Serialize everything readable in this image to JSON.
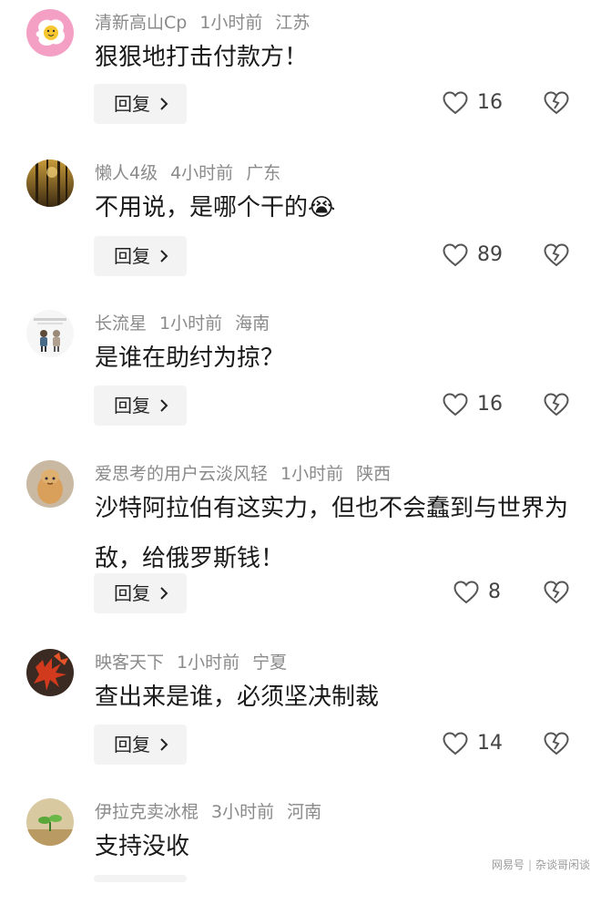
{
  "reply_label": "回复",
  "comments": [
    {
      "user": "清新高山Cp",
      "time": "1小时前",
      "location": "江苏",
      "text": "狠狠地打击付款方！",
      "likes": "16",
      "avatar": "fried-egg-avatar"
    },
    {
      "user": "懒人4级",
      "time": "4小时前",
      "location": "广东",
      "text": "不用说，是哪个干的",
      "emoji": "😭",
      "likes": "89",
      "avatar": "forest-avatar"
    },
    {
      "user": "长流星",
      "time": "1小时前",
      "location": "海南",
      "text": "是谁在助纣为掠？",
      "likes": "16",
      "avatar": "couple-illustration-avatar"
    },
    {
      "user": "爱思考的用户云淡风轻",
      "time": "1小时前",
      "location": "陕西",
      "text": "沙特阿拉伯有这实力，但也不会蠢到与世界为敌，给俄罗斯钱！",
      "likes": "8",
      "avatar": "cartoon-face-avatar"
    },
    {
      "user": "映客天下",
      "time": "1小时前",
      "location": "宁夏",
      "text": "查出来是谁，必须坚决制裁",
      "likes": "14",
      "avatar": "red-maple-avatar"
    },
    {
      "user": "伊拉克卖冰棍",
      "time": "3小时前",
      "location": "河南",
      "text": "支持没收",
      "avatar": "sprout-avatar"
    }
  ],
  "watermark": {
    "brand": "网易号",
    "account": "杂谈哥闲谈"
  },
  "colors": {
    "meta": "#8a8a8a",
    "text": "#1a1a1a",
    "reply_bg": "#f3f3f3",
    "icon": "#555555"
  }
}
